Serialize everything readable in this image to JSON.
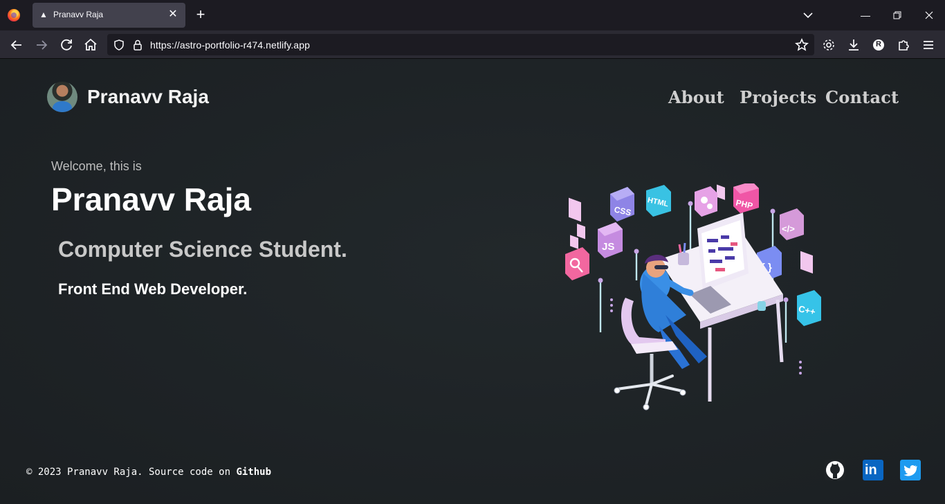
{
  "browser": {
    "tab_title": "Pranavv Raja",
    "url": "https://astro-portfolio-r474.netlify.app",
    "profile_initial": "R"
  },
  "header": {
    "brand_name": "Pranavv Raja",
    "nav": [
      "About",
      "Projects",
      "Contact"
    ]
  },
  "hero": {
    "welcome": "Welcome, this is",
    "name": "Pranavv Raja",
    "role_primary": "Computer Science Student.",
    "role_secondary": "Front End Web Developer."
  },
  "illustration": {
    "tech_labels": [
      "CSS",
      "HTML",
      "PHP",
      "JS",
      "</>",
      "{ }",
      "C++"
    ]
  },
  "footer": {
    "copyright": "© 2023 Pranavv Raja. Source code on ",
    "source_link": "Github"
  },
  "social": [
    "github-icon",
    "linkedin-icon",
    "twitter-icon"
  ],
  "colors": {
    "github_bg": "#ffffff",
    "linkedin_bg": "#0a66c2",
    "twitter_bg": "#1d9bf0"
  }
}
